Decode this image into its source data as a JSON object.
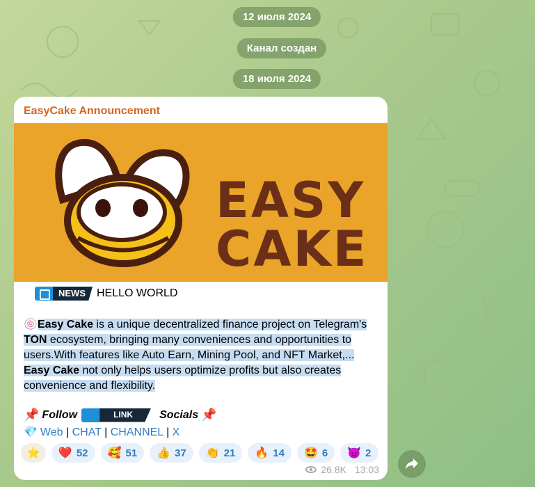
{
  "dates": [
    "12 июля 2024",
    "Канал создан",
    "18 июля 2024"
  ],
  "message": {
    "channel_name": "EasyCake Announcement",
    "banner": {
      "line1": "EASY",
      "line2": "CAKE",
      "background": "#e9a429",
      "text_color": "#6b2f17"
    },
    "news": {
      "badge_label": "NEWS",
      "headline": "HELLO WORLD"
    },
    "description": {
      "icon": "🍥",
      "parts": [
        {
          "text": "Easy Cake",
          "bold": true
        },
        {
          "text": " is a unique decentralized finance project on Telegram's ",
          "bold": false
        },
        {
          "text": "TON",
          "bold": true
        },
        {
          "text": " ecosystem, bringing many conveniences and opportunities to users.With features like Auto Earn, Mining Pool, and NFT Market,... ",
          "bold": false
        },
        {
          "text": "Easy Cake",
          "bold": true
        },
        {
          "text": " not only helps users optimize profits but also creates convenience and flexibility.",
          "bold": false
        }
      ]
    },
    "follow": {
      "pin_icon": "📌",
      "follow_label": "Follow",
      "link_badge": "LINK",
      "socials_label": "Socials"
    },
    "links": {
      "icon": "💎",
      "web": "Web",
      "chat": "CHAT",
      "channel": "CHANNEL",
      "x": "X",
      "separator": "|"
    },
    "reactions": [
      {
        "emoji": "⭐",
        "count": ""
      },
      {
        "emoji": "❤️",
        "count": "52"
      },
      {
        "emoji": "🥰",
        "count": "51"
      },
      {
        "emoji": "👍",
        "count": "37"
      },
      {
        "emoji": "👏",
        "count": "21"
      },
      {
        "emoji": "🔥",
        "count": "14"
      },
      {
        "emoji": "🤩",
        "count": "6"
      },
      {
        "emoji": "😈",
        "count": "2"
      }
    ],
    "views": "26.8K",
    "time": "13:03"
  },
  "colors": {
    "accent": "#2f7cc0",
    "channel_name": "#d1681f",
    "selection": "#c5dcf2"
  }
}
